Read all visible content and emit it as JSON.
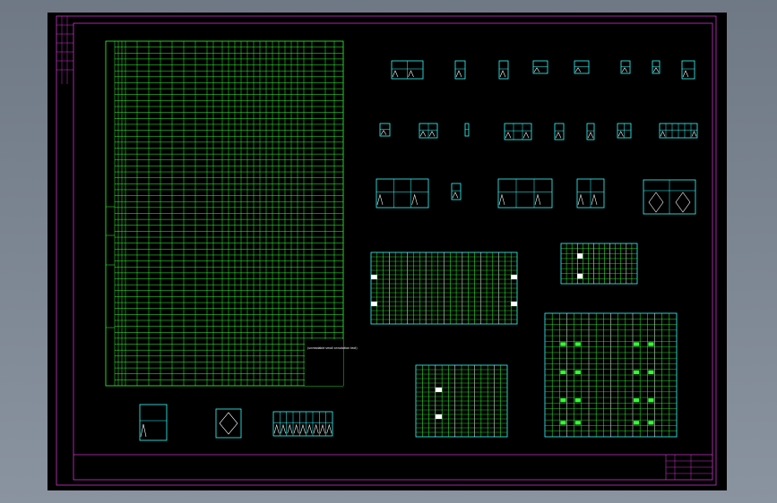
{
  "window": {
    "background_color": "#000000",
    "frame_color": "#cc33cc",
    "line_color_primary": "#33ff33",
    "line_color_secondary": "#33ffff"
  },
  "drawing": {
    "note_text": "(unreadable small annotation text)",
    "title_block": {
      "drawing_name": "",
      "fields": [
        "",
        "",
        "",
        ""
      ]
    }
  }
}
